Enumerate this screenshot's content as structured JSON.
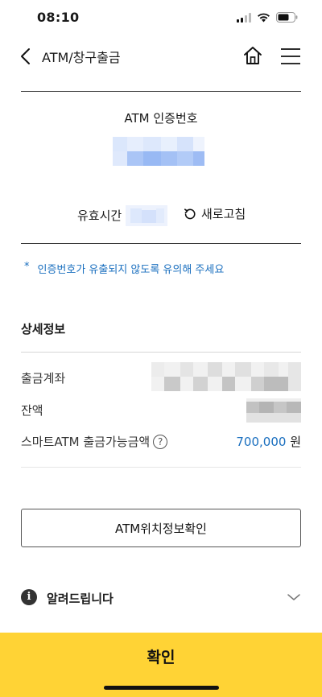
{
  "status_bar": {
    "time": "08:10"
  },
  "header": {
    "title": "ATM/창구출금"
  },
  "atm_code": {
    "label": "ATM 인증번호"
  },
  "validity": {
    "label": "유효시간",
    "refresh_label": "새로고침"
  },
  "notice": {
    "bullet": "*",
    "text": "인증번호가 유출되지 않도록 유의해 주세요"
  },
  "details": {
    "title": "상세정보",
    "account_label": "출금계좌",
    "balance_label": "잔액",
    "smart_atm_label": "스마트ATM 출금가능금액",
    "help_glyph": "?",
    "smart_atm_amount": "700,000",
    "currency": "원"
  },
  "atm_location_button": {
    "label": "ATM위치정보확인"
  },
  "info": {
    "label": "알려드립니다",
    "icon_glyph": "i"
  },
  "confirm_button": {
    "label": "확인"
  },
  "colors": {
    "accent": "#1a6fbf",
    "confirm_bg": "#ffd335"
  },
  "icons": [
    "back-icon",
    "home-icon",
    "menu-icon",
    "refresh-icon",
    "help-icon",
    "info-icon",
    "chevron-down-icon",
    "signal-icon",
    "wifi-icon",
    "battery-icon"
  ]
}
